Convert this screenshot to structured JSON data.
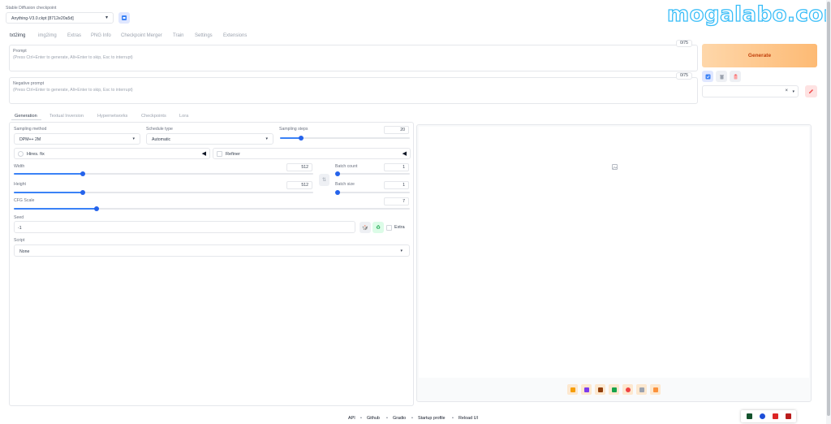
{
  "checkpoint": {
    "label": "Stable Diffusion checkpoint",
    "value": "Anything-V3.0.ckpt [8712e20a5d]"
  },
  "watermark": "mogalabo.com",
  "main_tabs": [
    "txt2img",
    "img2img",
    "Extras",
    "PNG Info",
    "Checkpoint Merger",
    "Train",
    "Settings",
    "Extensions"
  ],
  "prompt": {
    "label": "Prompt",
    "placeholder": "(Press Ctrl+Enter to generate, Alt+Enter to skip, Esc to interrupt)",
    "token_count": "0/75"
  },
  "negative_prompt": {
    "label": "Negative prompt",
    "placeholder": "(Press Ctrl+Enter to generate, Alt+Enter to skip, Esc to interrupt)",
    "token_count": "0/75"
  },
  "generate_label": "Generate",
  "sub_tabs": [
    "Generation",
    "Textual Inversion",
    "Hypernetworks",
    "Checkpoints",
    "Lora"
  ],
  "sampling_method": {
    "label": "Sampling method",
    "value": "DPM++ 2M"
  },
  "schedule_type": {
    "label": "Schedule type",
    "value": "Automatic"
  },
  "sampling_steps": {
    "label": "Sampling steps",
    "value": "20",
    "fraction": 0.16
  },
  "hires_fix": {
    "label": "Hires. fix"
  },
  "refiner": {
    "label": "Refiner"
  },
  "width": {
    "label": "Width",
    "value": "512",
    "fraction": 0.23
  },
  "height": {
    "label": "Height",
    "value": "512",
    "fraction": 0.23
  },
  "batch_count": {
    "label": "Batch count",
    "value": "1",
    "fraction": 0.0
  },
  "batch_size": {
    "label": "Batch size",
    "value": "1",
    "fraction": 0.0
  },
  "cfg_scale": {
    "label": "CFG Scale",
    "value": "7",
    "fraction": 0.21
  },
  "seed": {
    "label": "Seed",
    "value": "-1",
    "extra_label": "Extra"
  },
  "script": {
    "label": "Script",
    "value": "None"
  },
  "footer": {
    "links": [
      "API",
      "Github",
      "Gradio",
      "Startup profile",
      "Reload UI"
    ]
  },
  "colors": {
    "generate_gradient_start": "#fed7aa",
    "generate_gradient_end": "#fdba74",
    "slider": "#3b82f6",
    "watermark": "#38bdf8"
  }
}
